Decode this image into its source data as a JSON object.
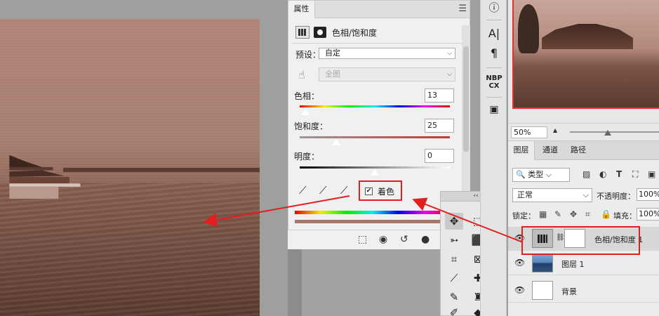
{
  "properties": {
    "tab_label": "属性",
    "menu_icon": "menu-icon",
    "adjustment_title": "色相/饱和度",
    "preset_label": "预设：",
    "preset_value": "自定",
    "channel_value": "全图",
    "hue_label": "色相：",
    "hue_value": "13",
    "saturation_label": "饱和度：",
    "saturation_value": "25",
    "lightness_label": "明度：",
    "lightness_value": "0",
    "colorize_label": "着色",
    "colorize_checked": true
  },
  "navigator": {
    "zoom_value": "50%"
  },
  "layers": {
    "tabs": [
      "图层",
      "通道",
      "路径"
    ],
    "kind_label": "类型",
    "blend_mode": "正常",
    "opacity_label": "不透明度：",
    "opacity_value": "100%",
    "lock_label": "锁定：",
    "fill_label": "填充：",
    "fill_value": "100%",
    "items": [
      {
        "name": "色相/饱和度 1"
      },
      {
        "name": "图层 1"
      },
      {
        "name": "背景"
      }
    ]
  },
  "strip": {
    "nbp_text": "NBP\nCX"
  },
  "colors": {
    "annotation_red": "#e02020",
    "sepia": "#a88071"
  }
}
